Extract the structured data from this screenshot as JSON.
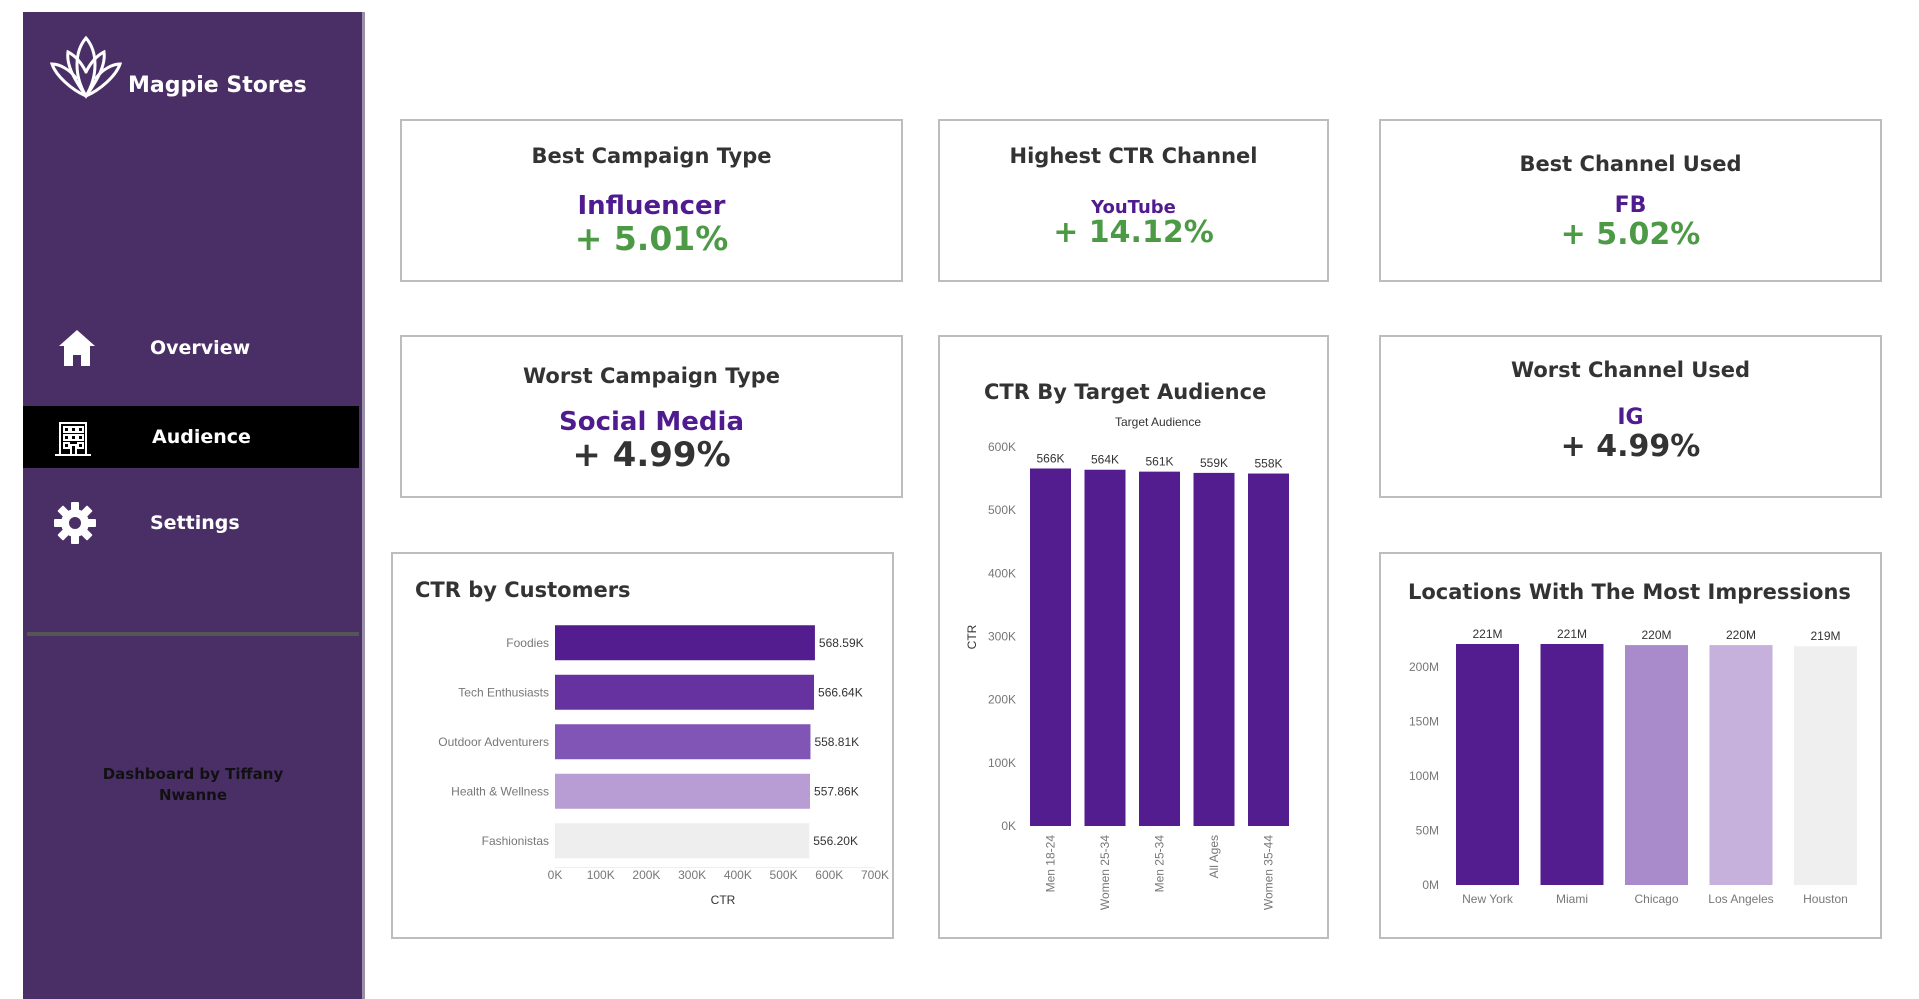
{
  "sidebar": {
    "brand": "Magpie Stores",
    "nav": [
      {
        "label": "Overview",
        "icon": "home-icon",
        "active": false
      },
      {
        "label": "Audience",
        "icon": "building-icon",
        "active": true
      },
      {
        "label": "Settings",
        "icon": "gear-icon",
        "active": false
      }
    ],
    "credit": "Dashboard by Tiffany Nwanne"
  },
  "kpis": {
    "best_campaign": {
      "title": "Best Campaign Type",
      "name": "Influencer",
      "value": "+ 5.01%"
    },
    "highest_ctr": {
      "title": "Highest CTR Channel",
      "name": "YouTube",
      "value": "+ 14.12%"
    },
    "best_channel": {
      "title": "Best Channel Used",
      "name": "FB",
      "value": "+ 5.02%"
    },
    "worst_campaign": {
      "title": "Worst Campaign Type",
      "name": "Social Media",
      "value": "+ 4.99%"
    },
    "worst_channel": {
      "title": "Worst Channel Used",
      "name": "IG",
      "value": "+ 4.99%"
    }
  },
  "colors": {
    "sidebar_bg": "#4a2f67",
    "accent_purple": "#4f1b8e",
    "positive_green": "#4c9a45"
  },
  "chart_data": [
    {
      "id": "customers",
      "type": "bar",
      "orientation": "horizontal",
      "title": "CTR by Customers",
      "xlabel": "CTR",
      "categories": [
        "Foodies",
        "Tech Enthusiasts",
        "Outdoor Adventurers",
        "Health & Wellness",
        "Fashionistas"
      ],
      "values": [
        568590,
        566640,
        558810,
        557860,
        556200
      ],
      "data_labels": [
        "568.59K",
        "566.64K",
        "558.81K",
        "557.86K",
        "556.20K"
      ],
      "colors": [
        "#531c8f",
        "#6632a0",
        "#8155b5",
        "#b89cd4",
        "#eeeeee"
      ],
      "xlim": [
        0,
        700000
      ],
      "ticks": [
        0,
        100000,
        200000,
        300000,
        400000,
        500000,
        600000,
        700000
      ],
      "tick_labels": [
        "0K",
        "100K",
        "200K",
        "300K",
        "400K",
        "500K",
        "600K",
        "700K"
      ]
    },
    {
      "id": "audience",
      "type": "bar",
      "orientation": "vertical",
      "title": "CTR  By Target Audience",
      "subtitle": "Target Audience",
      "ylabel": "CTR",
      "categories": [
        "Men 18-24",
        "Women 25-34",
        "Men 25-34",
        "All Ages",
        "Women 35-44"
      ],
      "values": [
        566000,
        564000,
        561000,
        559000,
        558000
      ],
      "data_labels": [
        "566K",
        "564K",
        "561K",
        "559K",
        "558K"
      ],
      "colors": [
        "#531c8f",
        "#531c8f",
        "#531c8f",
        "#531c8f",
        "#531c8f"
      ],
      "ylim": [
        0,
        600000
      ],
      "ticks": [
        0,
        100000,
        200000,
        300000,
        400000,
        500000,
        600000
      ],
      "tick_labels": [
        "0K",
        "100K",
        "200K",
        "300K",
        "400K",
        "500K",
        "600K"
      ]
    },
    {
      "id": "locations",
      "type": "bar",
      "orientation": "vertical",
      "title": "Locations With The Most Impressions",
      "categories": [
        "New York",
        "Miami",
        "Chicago",
        "Los Angeles",
        "Houston"
      ],
      "values": [
        221000000,
        221000000,
        220000000,
        220000000,
        219000000
      ],
      "data_labels": [
        "221M",
        "221M",
        "220M",
        "220M",
        "219M"
      ],
      "colors": [
        "#531c8f",
        "#531c8f",
        "#a98acb",
        "#c6b0dc",
        "#efefef"
      ],
      "ylim": [
        0,
        221000000
      ],
      "ticks": [
        0,
        50000000,
        100000000,
        150000000,
        200000000
      ],
      "tick_labels": [
        "0M",
        "50M",
        "100M",
        "150M",
        "200M"
      ]
    }
  ]
}
